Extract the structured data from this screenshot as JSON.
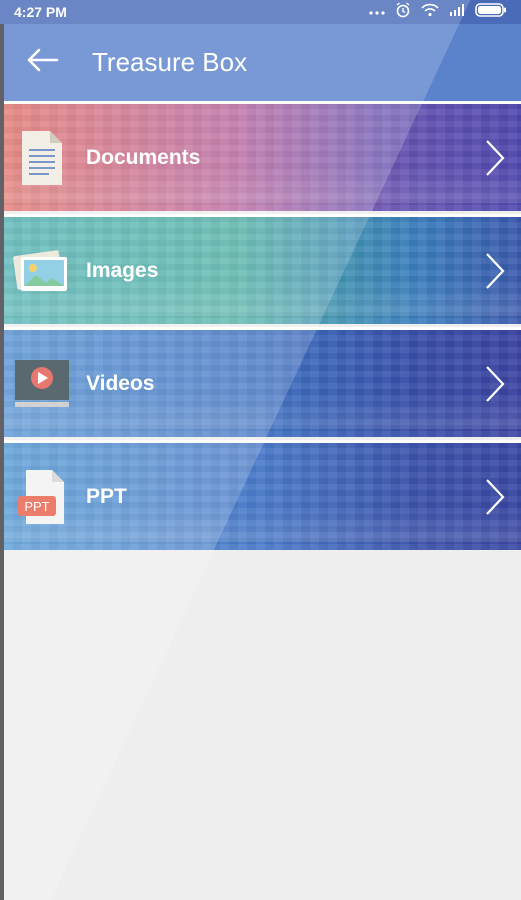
{
  "status_bar": {
    "time": "4:27 PM",
    "icons": [
      "more-dots-icon",
      "alarm-icon",
      "wifi-icon",
      "signal-icon",
      "battery-icon"
    ]
  },
  "app_bar": {
    "title": "Treasure Box",
    "back_icon": "arrow-left-icon"
  },
  "categories": [
    {
      "label": "Documents",
      "icon": "document-icon"
    },
    {
      "label": "Images",
      "icon": "image-icon"
    },
    {
      "label": "Videos",
      "icon": "video-icon"
    },
    {
      "label": "PPT",
      "icon": "ppt-icon",
      "icon_text": "PPT"
    }
  ],
  "colors": {
    "status_bar": "#4a6bb8",
    "app_bar": "#5b83cc",
    "background": "#efeeef",
    "ppt_badge": "#e8604a",
    "video_play": "#e25a4f"
  }
}
